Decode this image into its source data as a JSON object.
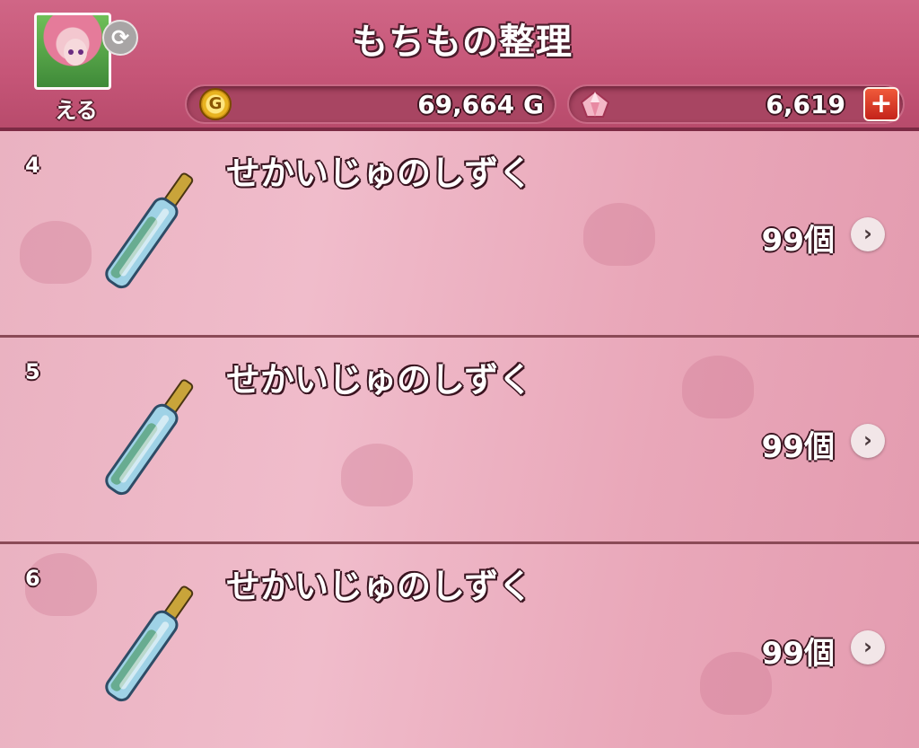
{
  "header": {
    "title": "もちもの整理",
    "player_name": "える",
    "gold": "69,664",
    "gold_unit": "G",
    "gold_icon_text": "G",
    "gems": "6,619",
    "plus_label": "+",
    "refresh_label": "⟳"
  },
  "items": [
    {
      "slot": "4",
      "name": "せかいじゅのしずく",
      "count": "99個",
      "chevron": "›"
    },
    {
      "slot": "5",
      "name": "せかいじゅのしずく",
      "count": "99個",
      "chevron": "›"
    },
    {
      "slot": "6",
      "name": "せかいじゅのしずく",
      "count": "99個",
      "chevron": "›"
    }
  ],
  "colors": {
    "header": "#c55577",
    "row_background": "#eab2c1",
    "divider": "#8b4a57",
    "plus_button": "#e04a2e"
  },
  "icons": {
    "avatar": "character-portrait",
    "refresh": "refresh-icon",
    "gold": "gold-coin-icon",
    "gem": "gem-icon",
    "item": "bottle-icon",
    "more": "chevron-right-icon"
  }
}
